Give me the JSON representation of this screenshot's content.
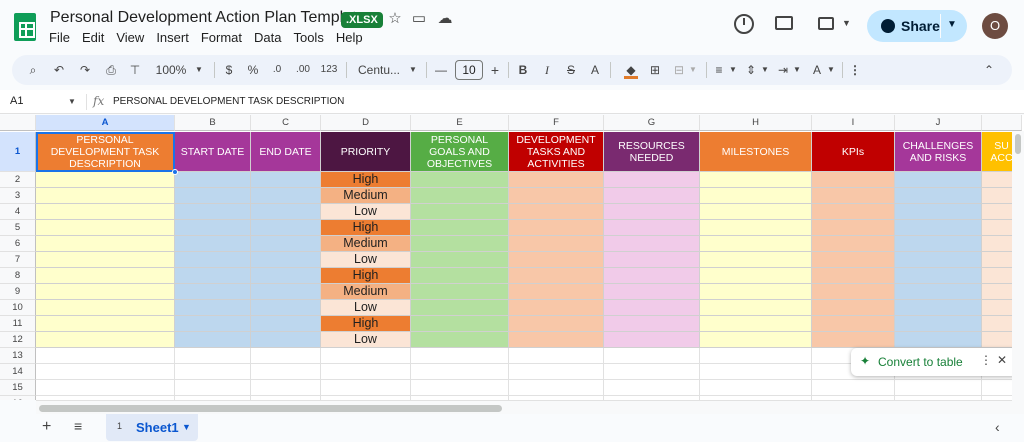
{
  "app": {
    "title": "Personal Development Action Plan Template",
    "format_badge": ".XLSX",
    "menu": [
      "File",
      "Edit",
      "View",
      "Insert",
      "Format",
      "Data",
      "Tools",
      "Help"
    ],
    "share_label": "Share",
    "avatar_initial": "O"
  },
  "toolbar": {
    "zoom": "100%",
    "currency": "$",
    "percent": "%",
    "dec_decrease": ".0",
    "dec_increase": ".00",
    "number_format": "123",
    "font": "Centu...",
    "font_size": "10",
    "bold": "B",
    "italic": "I",
    "strike": "S",
    "text_color": "A"
  },
  "formula_bar": {
    "name_box": "A1",
    "fx": "fx",
    "content": "PERSONAL DEVELOPMENT TASK  DESCRIPTION"
  },
  "columns": [
    "A",
    "B",
    "C",
    "D",
    "E",
    "F",
    "G",
    "H",
    "I",
    "J"
  ],
  "rows": [
    "1",
    "2",
    "3",
    "4",
    "5",
    "6",
    "7",
    "8",
    "9",
    "10",
    "11",
    "12",
    "13",
    "14",
    "15",
    "16"
  ],
  "headers": [
    {
      "text": "PERSONAL DEVELOPMENT TASK  DESCRIPTION",
      "bg": "#ed7d31"
    },
    {
      "text": "START DATE",
      "bg": "#a5379a"
    },
    {
      "text": "END DATE",
      "bg": "#a5379a"
    },
    {
      "text": "PRIORITY",
      "bg": "#4d1642"
    },
    {
      "text": "PERSONAL GOALS AND OBJECTIVES",
      "bg": "#56ad45"
    },
    {
      "text": "DEVELOPMENT TASKS AND ACTIVITIES",
      "bg": "#c00000"
    },
    {
      "text": "RESOURCES NEEDED",
      "bg": "#7a2a70"
    },
    {
      "text": "MILESTONES",
      "bg": "#ed7d31"
    },
    {
      "text": "KPIs",
      "bg": "#c00000"
    },
    {
      "text": "CHALLENGES AND RISKS",
      "bg": "#a5379a"
    },
    {
      "text": "SU ACC",
      "bg": "#ffc000"
    }
  ],
  "column_fills": [
    "#ffffcc",
    "#bdd7ee",
    "#bdd7ee",
    "",
    "#b4e0a0",
    "#f8c7a8",
    "#f1cbe9",
    "#ffffcc",
    "#f8c7a8",
    "#bdd7ee",
    "#fbe5d6"
  ],
  "priorities": [
    "High",
    "Medium",
    "Low",
    "High",
    "Medium",
    "Low",
    "High",
    "Medium",
    "Low",
    "High",
    "Low"
  ],
  "priority_colors": {
    "High": "#ed7d31",
    "Medium": "#f4b183",
    "Low": "#fbe5d6"
  },
  "popup": {
    "label": "Convert to table"
  },
  "sheet": {
    "number": "1",
    "name": "Sheet1"
  }
}
